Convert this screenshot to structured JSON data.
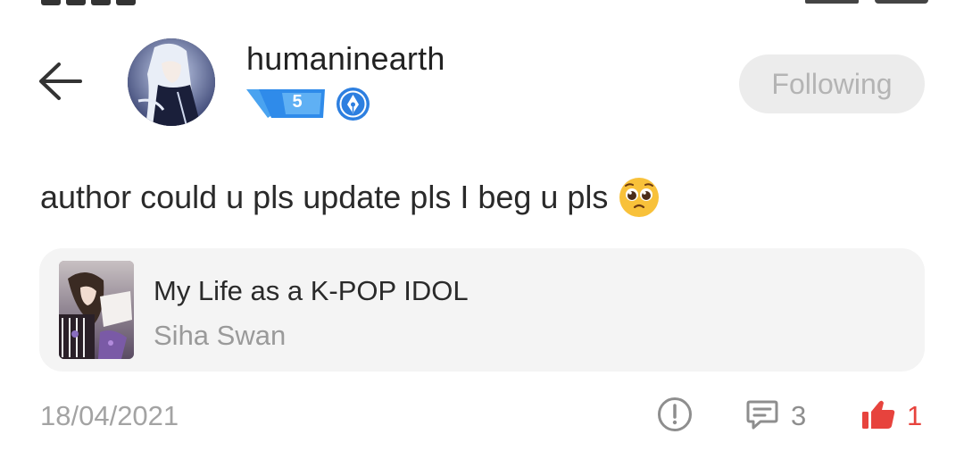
{
  "header": {
    "username": "humaninearth",
    "level": "5",
    "follow_label": "Following"
  },
  "comment": {
    "text": "author could u pls update pls I beg u pls",
    "emoji": "pleading-face"
  },
  "book": {
    "title": "My Life as a K-POP IDOL",
    "author": "Siha Swan"
  },
  "footer": {
    "date": "18/04/2021",
    "reply_count": "3",
    "like_count": "1"
  },
  "icons": {
    "back": "back-arrow-icon",
    "verified": "pen-badge-icon",
    "report": "exclamation-circle-icon",
    "reply": "comment-icon",
    "like": "thumbs-up-icon"
  },
  "colors": {
    "like_red": "#e7433d",
    "level_blue": "#2f8bea",
    "follow_bg": "#ececec",
    "follow_text": "#b4b4b4",
    "card_bg": "#f4f4f4"
  }
}
